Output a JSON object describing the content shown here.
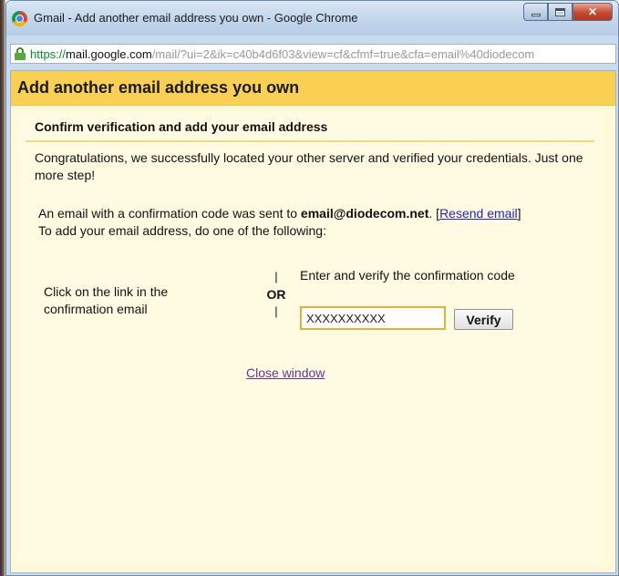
{
  "window": {
    "title": "Gmail - Add another email address you own - Google Chrome",
    "url_scheme": "https://",
    "url_host": "mail.google.com",
    "url_path": "/mail/?ui=2&ik=c40b4d6f03&view=cf&cfmf=true&cfa=email%40diodecom"
  },
  "dialog": {
    "title": "Add another email address you own",
    "section_title": "Confirm verification and add your email address",
    "congrats_text": "Congratulations, we successfully located your other server and verified your credentials. Just one more step!",
    "info_prefix": "An email with a confirmation code was sent to ",
    "email": "email@diodecom.net",
    "info_mid": ". [",
    "resend_label": "Resend email",
    "info_bracket_close": "]",
    "info_line2": "To add your email address, do one of the following:",
    "option_click": "Click on the link in the confirmation email",
    "or_bar": "|",
    "or_label": "OR",
    "option_enter": "Enter and verify the confirmation code",
    "code_value": "XXXXXXXXXX",
    "verify_label": "Verify",
    "close_label": "Close window"
  },
  "colors": {
    "header_bg": "#f9d051",
    "dialog_bg": "#fff9d9",
    "link": "#2222cc",
    "visited_link": "#663399"
  }
}
